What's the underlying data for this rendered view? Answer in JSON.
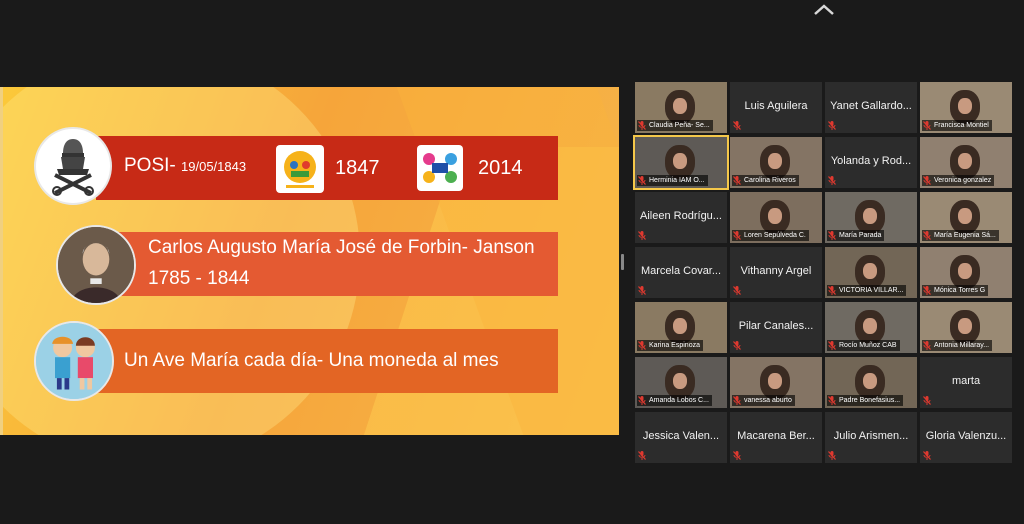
{
  "slide": {
    "posi_label": "POSI-",
    "posi_date": "19/05/1843",
    "year_1847": "1847",
    "year_2014": "2014",
    "founder_name": "Carlos Augusto María José de Forbin- Janson",
    "founder_years": "1785 - 1844",
    "motto": "Un Ave María cada día- Una moneda al mes"
  },
  "gallery": {
    "tiles": [
      {
        "label": "Claudia Peña- Se...",
        "kind": "video"
      },
      {
        "label": "Luis Aguilera",
        "kind": "name"
      },
      {
        "label": "Yanet Gallardo...",
        "kind": "name"
      },
      {
        "label": "Francisca Montiel",
        "kind": "video"
      },
      {
        "label": "Herminia IAM O...",
        "kind": "video"
      },
      {
        "label": "Carolina Riveros",
        "kind": "video"
      },
      {
        "label": "Yolanda y Rod...",
        "kind": "name"
      },
      {
        "label": "Veronica gonzalez",
        "kind": "video"
      },
      {
        "label": "Aileen Rodrígu...",
        "kind": "name"
      },
      {
        "label": "Loren Sepúlveda C.",
        "kind": "video"
      },
      {
        "label": "María Parada",
        "kind": "video"
      },
      {
        "label": "María Eugenia Sá...",
        "kind": "video"
      },
      {
        "label": "Marcela Covar...",
        "kind": "name"
      },
      {
        "label": "Vithanny Argel",
        "kind": "name"
      },
      {
        "label": "VICTORIA VILLAR...",
        "kind": "video"
      },
      {
        "label": "Mónica Torres G",
        "kind": "video"
      },
      {
        "label": "Karina Espinoza",
        "kind": "video"
      },
      {
        "label": "Pilar Canales...",
        "kind": "name"
      },
      {
        "label": "Rocío Muñoz CAB",
        "kind": "video"
      },
      {
        "label": "Antonia Millaray...",
        "kind": "video"
      },
      {
        "label": "Amanda Lobos C...",
        "kind": "video"
      },
      {
        "label": "vanessa aburto",
        "kind": "video"
      },
      {
        "label": "Padre Bonefasius...",
        "kind": "video"
      },
      {
        "label": "marta",
        "kind": "name"
      },
      {
        "label": "Jessica Valen...",
        "kind": "name"
      },
      {
        "label": "Macarena Ber...",
        "kind": "name"
      },
      {
        "label": "Julio Arismen...",
        "kind": "name"
      },
      {
        "label": "Gloria Valenzu...",
        "kind": "name"
      }
    ]
  },
  "icons": {
    "top": "chevron-up-icon",
    "muted": "mic-muted-icon"
  },
  "colors": {
    "bar_dark_red": "#c72a16",
    "bar_orange": "#e45a32",
    "mic_muted": "#e0392f",
    "active_speaker": "#f5c84a"
  }
}
